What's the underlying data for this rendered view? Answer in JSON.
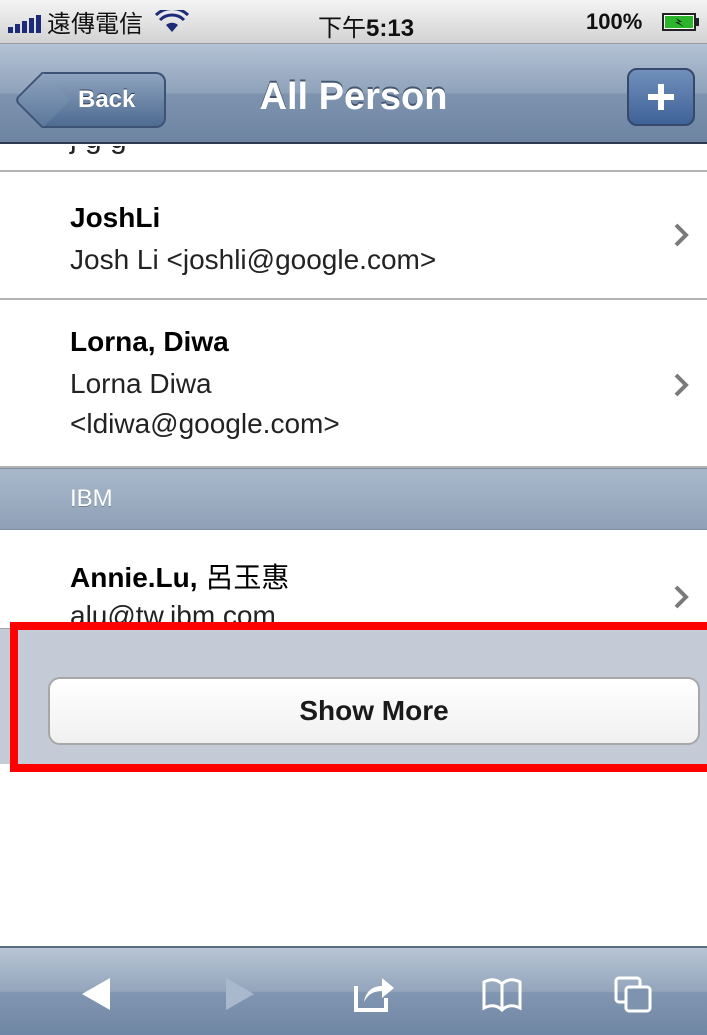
{
  "status_bar": {
    "carrier": "遠傳電信",
    "time_prefix": "下午",
    "time": "5:13",
    "battery": "100%",
    "icons": [
      "signal-icon",
      "wifi-icon",
      "battery-icon"
    ]
  },
  "nav": {
    "back_label": "Back",
    "title": "All Person",
    "add_label": "+"
  },
  "list": {
    "cut_text": "j        g    g",
    "rows": [
      {
        "name": "JoshLi",
        "lines": [
          "Josh Li <joshli@google.com>"
        ]
      },
      {
        "name": "Lorna, Diwa",
        "lines": [
          "Lorna Diwa",
          "<ldiwa@google.com>"
        ]
      },
      {
        "name": "Annie.Lu,",
        "name_extra": "呂玉惠",
        "lines": [
          "alu@tw.ibm.com"
        ]
      }
    ],
    "section_header": "IBM"
  },
  "show_more": {
    "label": "Show More"
  },
  "toolbar": {
    "items": [
      "back-arrow-icon",
      "forward-arrow-icon",
      "share-icon",
      "bookmarks-icon",
      "pages-icon"
    ]
  },
  "colors": {
    "nav_blue": "#7e93ae",
    "highlight": "#ff0000",
    "section_header": "#98a9be"
  }
}
